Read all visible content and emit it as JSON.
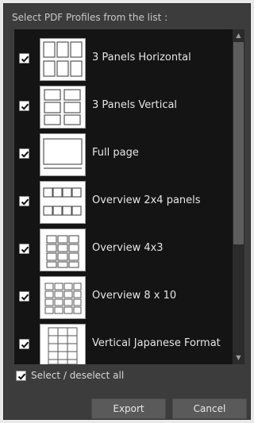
{
  "dialog": {
    "prompt": "Select PDF Profiles from the list :",
    "profiles": [
      {
        "label": "3 Panels Horizontal",
        "checked": true,
        "thumb": "three-columns-icon"
      },
      {
        "label": "3 Panels Vertical",
        "checked": true,
        "thumb": "three-rows-icon"
      },
      {
        "label": "Full page",
        "checked": true,
        "thumb": "full-page-icon"
      },
      {
        "label": "Overview 2x4 panels",
        "checked": true,
        "thumb": "grid-2x4-icon"
      },
      {
        "label": "Overview 4x3",
        "checked": true,
        "thumb": "grid-4x3-icon"
      },
      {
        "label": "Overview 8 x 10",
        "checked": true,
        "thumb": "grid-8x10-icon"
      },
      {
        "label": "Vertical Japanese Format",
        "checked": true,
        "thumb": "vertical-japanese-icon"
      }
    ],
    "select_all_label": "Select / deselect all",
    "select_all_checked": true,
    "export_label": "Export",
    "cancel_label": "Cancel"
  },
  "colors": {
    "dialog_bg": "#3c3c3c",
    "list_bg": "#141414",
    "button_bg": "#5a5a5a"
  }
}
